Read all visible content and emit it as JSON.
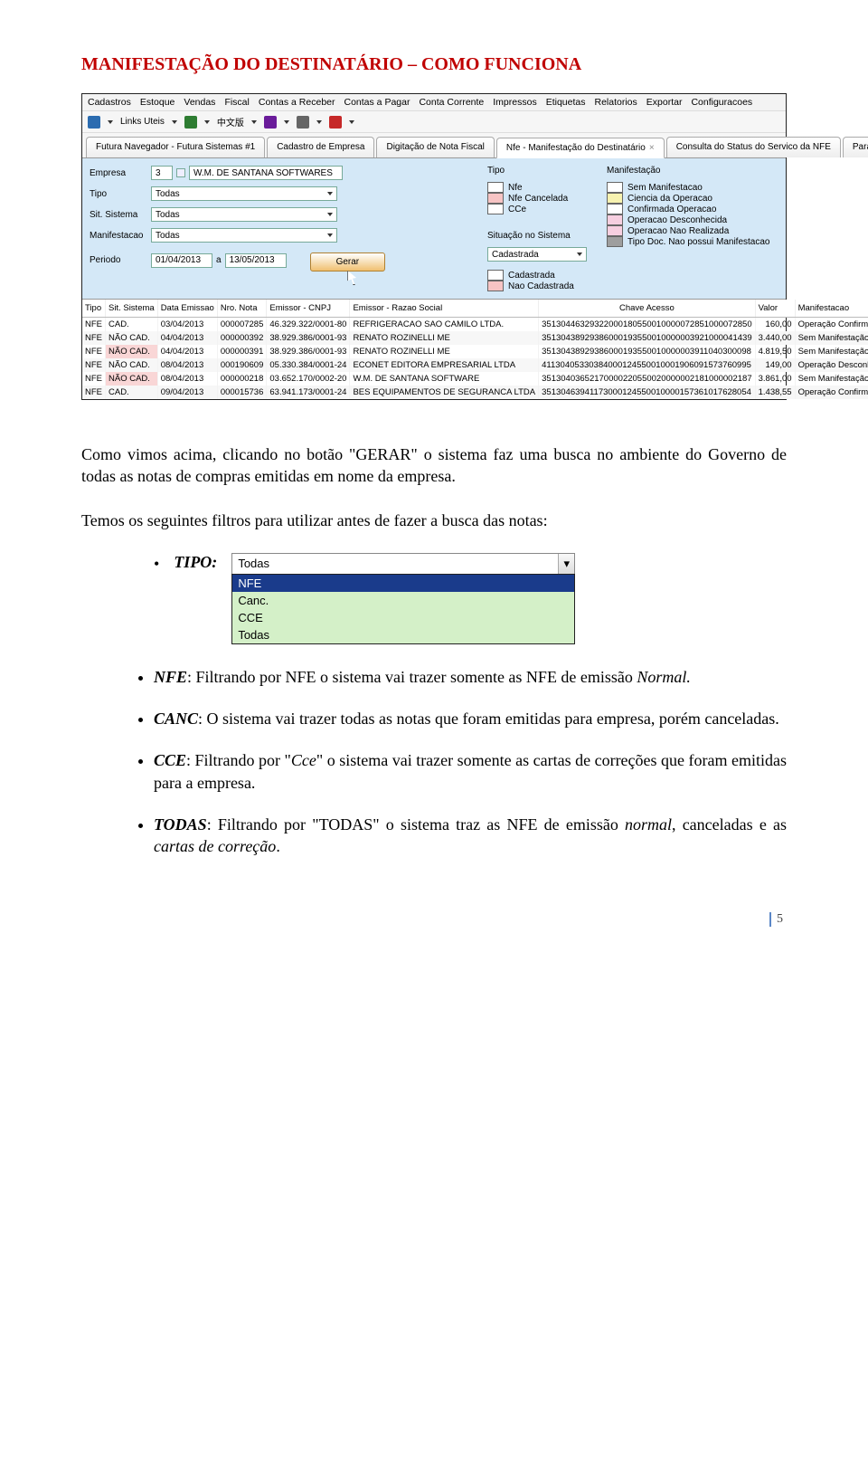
{
  "doc": {
    "title": "MANIFESTAÇÃO DO DESTINATÁRIO – COMO FUNCIONA",
    "para_intro": "Como vimos acima, clicando no botão \"GERAR\" o sistema faz uma busca no ambiente do Governo de todas as notas de compras emitidas em nome da empresa.",
    "para_filters": "Temos os seguintes filtros para utilizar antes de fazer a busca das notas:",
    "tipo_label": "TIPO:",
    "page_number": "5"
  },
  "menus": [
    "Cadastros",
    "Estoque",
    "Vendas",
    "Fiscal",
    "Contas a Receber",
    "Contas a Pagar",
    "Conta Corrente",
    "Impressos",
    "Etiquetas",
    "Relatorios",
    "Exportar",
    "Configuracoes"
  ],
  "toolbar": {
    "links_label": "Links Uteis",
    "chinese": "中文版"
  },
  "tabs": [
    {
      "label": "Futura Navegador - Futura Sistemas #1",
      "close": false
    },
    {
      "label": "Cadastro de Empresa",
      "close": false
    },
    {
      "label": "Digitação de Nota Fiscal",
      "close": false
    },
    {
      "label": "Nfe - Manifestação do Destinatário",
      "close": true,
      "active": true
    },
    {
      "label": "Consulta do Status do Servico da NFE",
      "close": false
    },
    {
      "label": "Parametros I",
      "close": false
    }
  ],
  "filters": {
    "empresa_label": "Empresa",
    "empresa_code": "3",
    "empresa_name": "W.M. DE SANTANA SOFTWARES",
    "tipo_label": "Tipo",
    "tipo_value": "Todas",
    "sit_label": "Sit. Sistema",
    "sit_value": "Todas",
    "manif_label": "Manifestacao",
    "manif_value": "Todas",
    "periodo_label": "Periodo",
    "periodo_from": "01/04/2013",
    "periodo_sep": "a",
    "periodo_to": "13/05/2013",
    "btn_gerar": "Gerar",
    "situ_box_label": "Situação no Sistema",
    "situ_value": "Cadastrada"
  },
  "legend_tipo": {
    "title": "Tipo",
    "items": [
      {
        "label": "Nfe",
        "color": "#ffffff"
      },
      {
        "label": "Nfe Cancelada",
        "color": "#f7c4c4"
      },
      {
        "label": "CCe",
        "color": "#ffffff"
      }
    ]
  },
  "legend_sit": {
    "items": [
      {
        "label": "Cadastrada",
        "color": "#ffffff"
      },
      {
        "label": "Nao Cadastrada",
        "color": "#f7c4c4"
      }
    ]
  },
  "legend_manif": {
    "title": "Manifestação",
    "items": [
      {
        "label": "Sem Manifestacao",
        "color": "#ffffff"
      },
      {
        "label": "Ciencia da Operacao",
        "color": "#f7f2b0"
      },
      {
        "label": "Confirmada Operacao",
        "color": "#ffffff"
      },
      {
        "label": "Operacao Desconhecida",
        "color": "#f7cfe0"
      },
      {
        "label": "Operacao Nao Realizada",
        "color": "#f7cfe0"
      },
      {
        "label": "Tipo Doc. Nao possui Manifestacao",
        "color": "#9e9e9e"
      }
    ]
  },
  "columns": [
    "Tipo",
    "Sit. Sistema",
    "Data Emissao",
    "Nro. Nota",
    "Emissor - CNPJ",
    "Emissor - Razao Social",
    "Chave Acesso",
    "Valor",
    "Manifestacao"
  ],
  "rows": [
    {
      "tipo": "NFE",
      "sit": "CAD.",
      "sit_pink": false,
      "data": "03/04/2013",
      "nro": "000007285",
      "cnpj": "46.329.322/0001-80",
      "razao": "REFRIGERACAO SAO CAMILO LTDA.",
      "chave": "35130446329322000180550010000072851000072850",
      "valor": "160,00",
      "manif": "Operação Confirmada",
      "manif_pink": false
    },
    {
      "tipo": "NFE",
      "sit": "NÃO CAD.",
      "sit_pink": true,
      "data": "04/04/2013",
      "nro": "000000392",
      "cnpj": "38.929.386/0001-93",
      "razao": "RENATO ROZINELLI ME",
      "chave": "35130438929386000193550010000003921000041439",
      "valor": "3.440,00",
      "manif": "Sem Manifestação",
      "manif_pink": false
    },
    {
      "tipo": "NFE",
      "sit": "NÃO CAD.",
      "sit_pink": true,
      "data": "04/04/2013",
      "nro": "000000391",
      "cnpj": "38.929.386/0001-93",
      "razao": "RENATO ROZINELLI ME",
      "chave": "35130438929386000193550010000003911040300098",
      "valor": "4.819,50",
      "manif": "Sem Manifestação",
      "manif_pink": false
    },
    {
      "tipo": "NFE",
      "sit": "NÃO CAD.",
      "sit_pink": true,
      "data": "08/04/2013",
      "nro": "000190609",
      "cnpj": "05.330.384/0001-24",
      "razao": "ECONET EDITORA EMPRESARIAL LTDA",
      "chave": "41130405330384000124550010001906091573760995",
      "valor": "149,00",
      "manif": "Operação Desconhecida",
      "manif_pink": true
    },
    {
      "tipo": "NFE",
      "sit": "NÃO CAD.",
      "sit_pink": true,
      "data": "08/04/2013",
      "nro": "000000218",
      "cnpj": "03.652.170/0002-20",
      "razao": "W.M. DE SANTANA SOFTWARE",
      "chave": "35130403652170000220550020000002181000002187",
      "valor": "3.861,00",
      "manif": "Sem Manifestação",
      "manif_pink": false
    },
    {
      "tipo": "NFE",
      "sit": "CAD.",
      "sit_pink": false,
      "data": "09/04/2013",
      "nro": "000015736",
      "cnpj": "63.941.173/0001-24",
      "razao": "BES EQUIPAMENTOS DE SEGURANCA LTDA",
      "chave": "35130463941173000124550010000157361017628054",
      "valor": "1.438,55",
      "manif": "Operação Confirmada",
      "manif_pink": false
    }
  ],
  "tipo_dropdown": {
    "selected": "Todas",
    "options": [
      "NFE",
      "Canc.",
      "CCE",
      "Todas"
    ],
    "highlight": "NFE"
  },
  "bullets": [
    {
      "term": "NFE",
      "text": ": Filtrando por NFE o sistema vai trazer somente as NFE de emissão ",
      "tail_italic": "Normal.",
      "tail": ""
    },
    {
      "term": "CANC",
      "text": ": O sistema vai trazer todas as notas que foram emitidas para empresa, porém canceladas.",
      "tail_italic": "",
      "tail": ""
    },
    {
      "term": "CCE",
      "text": ": Filtrando por \"",
      "tail_italic": "Cce",
      "tail": "\" o sistema vai trazer somente as cartas de correções que foram emitidas para a empresa."
    },
    {
      "term": "TODAS",
      "text": ": Filtrando por \"TODAS\" o sistema traz as NFE de emissão ",
      "tail_italic": "normal",
      "tail": ", canceladas e as cartas de correção.",
      "extra_italic": "cartas de correção"
    }
  ]
}
